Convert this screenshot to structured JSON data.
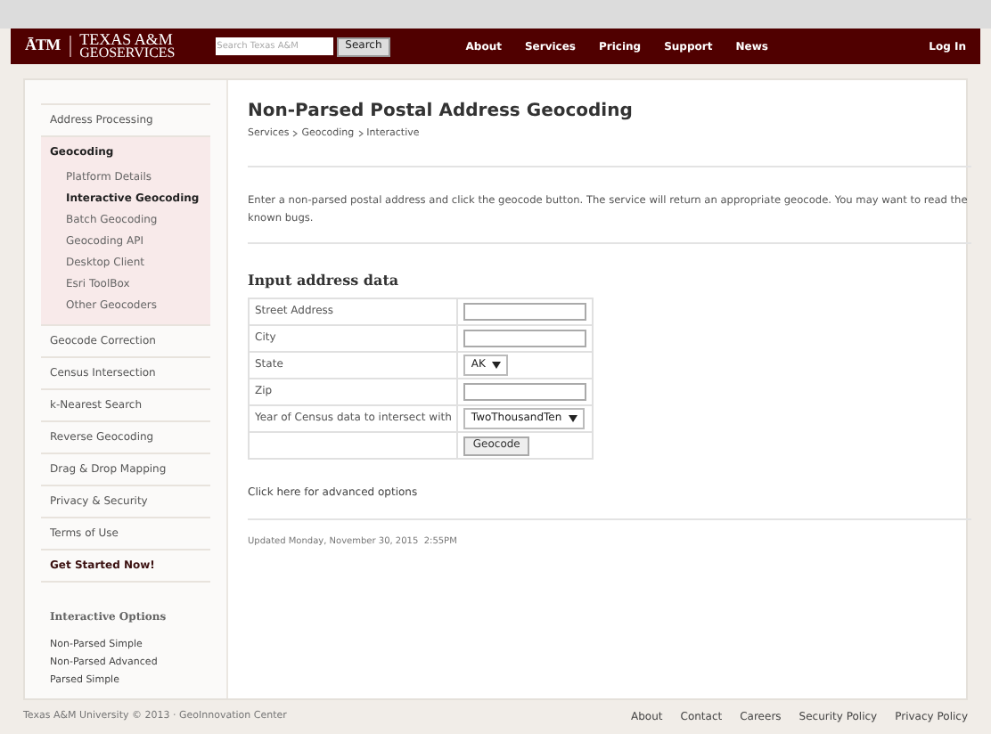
{
  "header": {
    "logo_mark": "ĀTM",
    "logo_line1": "TEXAS A&M",
    "logo_line2": "GEOSERVICES",
    "search": {
      "placeholder": "Search Texas A&M"
    },
    "search_button": "Search",
    "nav": [
      {
        "label": "About"
      },
      {
        "label": "Services"
      },
      {
        "label": "Pricing"
      },
      {
        "label": "Support"
      },
      {
        "label": "News"
      }
    ],
    "login": "Log In"
  },
  "sidebar": {
    "items": [
      {
        "label": "Address Processing",
        "selected": false
      },
      {
        "label": "Geocoding",
        "selected": true,
        "expanded": true,
        "children": [
          {
            "label": "Platform Details",
            "selected": false
          },
          {
            "label": "Interactive Geocoding",
            "selected": true
          },
          {
            "label": "Batch Geocoding",
            "selected": false
          },
          {
            "label": "Geocoding API",
            "selected": false
          },
          {
            "label": "Desktop Client",
            "selected": false
          },
          {
            "label": "Esri ToolBox",
            "selected": false
          },
          {
            "label": "Other Geocoders",
            "selected": false
          }
        ]
      },
      {
        "label": "Geocode Correction",
        "selected": false
      },
      {
        "label": "Census Intersection",
        "selected": false
      },
      {
        "label": "k-Nearest Search",
        "selected": false
      },
      {
        "label": "Reverse Geocoding",
        "selected": false
      },
      {
        "label": "Drag & Drop Mapping",
        "selected": false
      },
      {
        "label": "Privacy & Security",
        "selected": false
      },
      {
        "label": "Terms of Use",
        "selected": false
      },
      {
        "label": "Get Started Now!",
        "selected": false,
        "kind": "cta"
      }
    ],
    "options_title": "Interactive Options",
    "options": [
      "Non-Parsed Simple",
      "Non-Parsed Advanced",
      "Parsed Simple"
    ]
  },
  "main": {
    "title": "Non-Parsed Postal Address Geocoding",
    "breadcrumb": [
      "Services",
      "Geocoding",
      "Interactive"
    ],
    "intro": "Enter a non-parsed postal address and click the geocode button. The service will return an appropriate geocode. You may want to read the known bugs.",
    "form_title": "Input address data",
    "rows": [
      {
        "label": "Street Address",
        "kind": "text"
      },
      {
        "label": "City",
        "kind": "text"
      },
      {
        "label": "State",
        "kind": "select",
        "value": "AK"
      },
      {
        "label": "Zip",
        "kind": "text"
      },
      {
        "label": "Year of Census data to intersect with",
        "kind": "select",
        "value": "TwoThousandTen"
      },
      {
        "kind": "button",
        "value": "Geocode"
      }
    ],
    "advanced_link": "Click here for advanced options",
    "updated": "Updated Monday, November 30, 2015  2:55PM"
  },
  "footer": {
    "copyright": "Texas A&M University © 2013 · GeoInnovation Center",
    "links": [
      "About",
      "Contact",
      "Careers",
      "Security Policy",
      "Privacy Policy"
    ]
  }
}
